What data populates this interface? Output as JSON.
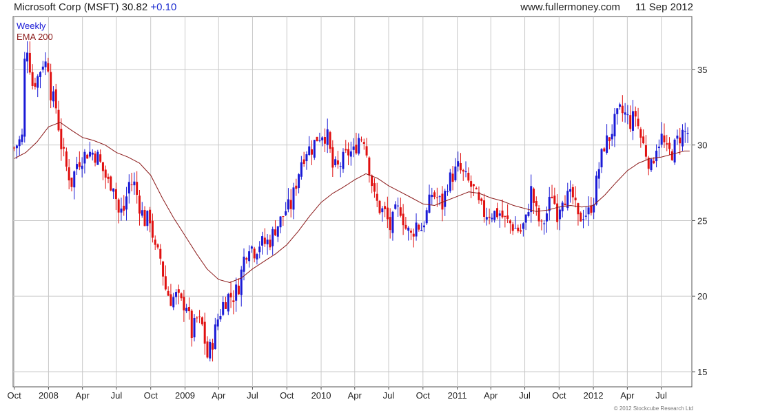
{
  "header": {
    "title": "Microsoft Corp (MSFT) 30.82",
    "change": "+0.10",
    "site": "www.fullermoney.com",
    "date": "11 Sep 2012"
  },
  "copyright": "© 2012 Stockcube Research Ltd",
  "colors": {
    "up": "#1a1ad6",
    "down": "#e01010",
    "ema": "#8b1a1a",
    "grid": "#c8c8c8",
    "legend_weekly": "#1a1ad6",
    "legend_ema": "#8b1a1a"
  },
  "chart_data": {
    "type": "candlestick",
    "legend": [
      "Weekly",
      "EMA 200"
    ],
    "legend_placement": "top-left",
    "grid": true,
    "y_axis_side": "right",
    "ylim": [
      14,
      38.5
    ],
    "y_ticks": [
      15,
      20,
      25,
      30,
      35
    ],
    "x_tick_labels": [
      "Oct",
      "2008",
      "Apr",
      "Jul",
      "Oct",
      "2009",
      "Apr",
      "Jul",
      "Oct",
      "2010",
      "Apr",
      "Jul",
      "Oct",
      "2011",
      "Apr",
      "Jul",
      "Oct",
      "2012",
      "Apr",
      "Jul"
    ],
    "x_tick_months": [
      "2007-10",
      "2008-01",
      "2008-04",
      "2008-07",
      "2008-10",
      "2009-01",
      "2009-04",
      "2009-07",
      "2009-10",
      "2010-01",
      "2010-04",
      "2010-07",
      "2010-10",
      "2011-01",
      "2011-04",
      "2011-07",
      "2011-10",
      "2012-01",
      "2012-04",
      "2012-07"
    ],
    "xlim": [
      "2007-09-28",
      "2012-09-21"
    ],
    "price_series": [
      [
        "2007-10-01",
        29.8
      ],
      [
        "2007-10-22",
        30.5
      ],
      [
        "2007-10-29",
        35.5
      ],
      [
        "2007-11-05",
        36.5
      ],
      [
        "2007-11-19",
        34.0
      ],
      [
        "2007-12-03",
        34.5
      ],
      [
        "2007-12-17",
        35.5
      ],
      [
        "2007-12-31",
        35.3
      ],
      [
        "2008-01-07",
        33.5
      ],
      [
        "2008-01-21",
        32.5
      ],
      [
        "2008-02-04",
        30.0
      ],
      [
        "2008-02-18",
        28.5
      ],
      [
        "2008-03-03",
        27.5
      ],
      [
        "2008-03-17",
        28.8
      ],
      [
        "2008-03-31",
        29.2
      ],
      [
        "2008-04-14",
        29.5
      ],
      [
        "2008-04-28",
        29.5
      ],
      [
        "2008-05-12",
        29.2
      ],
      [
        "2008-05-26",
        28.3
      ],
      [
        "2008-06-09",
        27.5
      ],
      [
        "2008-06-23",
        27.5
      ],
      [
        "2008-07-07",
        25.5
      ],
      [
        "2008-07-21",
        25.7
      ],
      [
        "2008-08-04",
        27.5
      ],
      [
        "2008-08-18",
        27.4
      ],
      [
        "2008-09-01",
        26.0
      ],
      [
        "2008-09-15",
        25.0
      ],
      [
        "2008-09-29",
        25.2
      ],
      [
        "2008-10-13",
        23.0
      ],
      [
        "2008-10-27",
        22.5
      ],
      [
        "2008-11-10",
        20.5
      ],
      [
        "2008-11-24",
        19.8
      ],
      [
        "2008-12-08",
        20.0
      ],
      [
        "2008-12-22",
        19.5
      ],
      [
        "2009-01-05",
        19.5
      ],
      [
        "2009-01-19",
        17.5
      ],
      [
        "2009-02-02",
        18.5
      ],
      [
        "2009-02-16",
        18.0
      ],
      [
        "2009-03-02",
        16.0
      ],
      [
        "2009-03-16",
        17.0
      ],
      [
        "2009-03-30",
        18.5
      ],
      [
        "2009-04-13",
        19.5
      ],
      [
        "2009-04-27",
        20.0
      ],
      [
        "2009-05-11",
        20.0
      ],
      [
        "2009-05-25",
        20.7
      ],
      [
        "2009-06-08",
        22.5
      ],
      [
        "2009-06-22",
        23.5
      ],
      [
        "2009-07-06",
        23.0
      ],
      [
        "2009-07-20",
        23.5
      ],
      [
        "2009-08-03",
        23.5
      ],
      [
        "2009-08-17",
        23.7
      ],
      [
        "2009-08-31",
        24.5
      ],
      [
        "2009-09-14",
        25.0
      ],
      [
        "2009-09-28",
        25.7
      ],
      [
        "2009-10-12",
        26.0
      ],
      [
        "2009-10-26",
        27.5
      ],
      [
        "2009-11-09",
        29.0
      ],
      [
        "2009-11-23",
        29.7
      ],
      [
        "2009-12-07",
        29.8
      ],
      [
        "2009-12-21",
        30.5
      ],
      [
        "2010-01-04",
        30.8
      ],
      [
        "2010-01-18",
        30.5
      ],
      [
        "2010-02-01",
        28.5
      ],
      [
        "2010-02-15",
        28.5
      ],
      [
        "2010-03-01",
        29.0
      ],
      [
        "2010-03-15",
        29.5
      ],
      [
        "2010-03-29",
        29.5
      ],
      [
        "2010-04-12",
        30.5
      ],
      [
        "2010-04-26",
        30.5
      ],
      [
        "2010-05-10",
        28.5
      ],
      [
        "2010-05-24",
        26.5
      ],
      [
        "2010-06-07",
        25.8
      ],
      [
        "2010-06-21",
        25.5
      ],
      [
        "2010-07-05",
        24.5
      ],
      [
        "2010-07-19",
        25.5
      ],
      [
        "2010-08-02",
        25.8
      ],
      [
        "2010-08-16",
        24.5
      ],
      [
        "2010-08-30",
        24.0
      ],
      [
        "2010-09-13",
        24.8
      ],
      [
        "2010-09-27",
        24.5
      ],
      [
        "2010-10-11",
        25.5
      ],
      [
        "2010-10-25",
        26.8
      ],
      [
        "2010-11-08",
        26.5
      ],
      [
        "2010-11-22",
        26.0
      ],
      [
        "2010-12-06",
        27.5
      ],
      [
        "2010-12-20",
        28.0
      ],
      [
        "2011-01-03",
        28.5
      ],
      [
        "2011-01-17",
        28.0
      ],
      [
        "2011-01-31",
        27.5
      ],
      [
        "2011-02-14",
        27.0
      ],
      [
        "2011-02-28",
        26.0
      ],
      [
        "2011-03-14",
        25.5
      ],
      [
        "2011-03-28",
        25.5
      ],
      [
        "2011-04-11",
        25.5
      ],
      [
        "2011-04-25",
        25.5
      ],
      [
        "2011-05-09",
        25.0
      ],
      [
        "2011-05-23",
        24.8
      ],
      [
        "2011-06-06",
        24.5
      ],
      [
        "2011-06-20",
        24.3
      ],
      [
        "2011-07-04",
        25.0
      ],
      [
        "2011-07-18",
        27.0
      ],
      [
        "2011-08-01",
        25.5
      ],
      [
        "2011-08-15",
        24.5
      ],
      [
        "2011-08-29",
        25.5
      ],
      [
        "2011-09-12",
        26.8
      ],
      [
        "2011-09-26",
        25.5
      ],
      [
        "2011-10-10",
        26.7
      ],
      [
        "2011-10-24",
        26.5
      ],
      [
        "2011-11-07",
        26.5
      ],
      [
        "2011-11-21",
        25.0
      ],
      [
        "2011-12-05",
        25.5
      ],
      [
        "2011-12-19",
        25.5
      ],
      [
        "2012-01-02",
        26.5
      ],
      [
        "2012-01-16",
        28.5
      ],
      [
        "2012-01-30",
        30.0
      ],
      [
        "2012-02-13",
        30.5
      ],
      [
        "2012-02-27",
        31.5
      ],
      [
        "2012-03-12",
        32.2
      ],
      [
        "2012-03-26",
        32.0
      ],
      [
        "2012-04-09",
        31.5
      ],
      [
        "2012-04-23",
        32.0
      ],
      [
        "2012-05-07",
        30.5
      ],
      [
        "2012-05-21",
        29.5
      ],
      [
        "2012-06-04",
        28.5
      ],
      [
        "2012-06-18",
        30.0
      ],
      [
        "2012-07-02",
        30.5
      ],
      [
        "2012-07-16",
        29.5
      ],
      [
        "2012-07-30",
        29.5
      ],
      [
        "2012-08-13",
        30.3
      ],
      [
        "2012-08-27",
        30.8
      ],
      [
        "2012-09-10",
        30.82
      ]
    ],
    "ema_series": [
      [
        "2007-10-01",
        29.1
      ],
      [
        "2007-11-01",
        29.5
      ],
      [
        "2007-12-01",
        30.2
      ],
      [
        "2008-01-01",
        31.2
      ],
      [
        "2008-02-01",
        31.5
      ],
      [
        "2008-03-01",
        31.0
      ],
      [
        "2008-04-01",
        30.5
      ],
      [
        "2008-05-01",
        30.3
      ],
      [
        "2008-06-01",
        30.0
      ],
      [
        "2008-07-01",
        29.5
      ],
      [
        "2008-08-01",
        29.2
      ],
      [
        "2008-09-01",
        28.8
      ],
      [
        "2008-10-01",
        28.0
      ],
      [
        "2008-11-01",
        26.5
      ],
      [
        "2008-12-01",
        25.2
      ],
      [
        "2009-01-01",
        24.0
      ],
      [
        "2009-02-01",
        22.8
      ],
      [
        "2009-03-01",
        21.8
      ],
      [
        "2009-04-01",
        21.1
      ],
      [
        "2009-05-01",
        20.9
      ],
      [
        "2009-06-01",
        21.2
      ],
      [
        "2009-07-01",
        21.8
      ],
      [
        "2009-08-01",
        22.3
      ],
      [
        "2009-09-01",
        22.8
      ],
      [
        "2009-10-01",
        23.4
      ],
      [
        "2009-11-01",
        24.3
      ],
      [
        "2009-12-01",
        25.3
      ],
      [
        "2010-01-01",
        26.2
      ],
      [
        "2010-02-01",
        26.8
      ],
      [
        "2010-03-01",
        27.2
      ],
      [
        "2010-04-01",
        27.7
      ],
      [
        "2010-05-01",
        28.1
      ],
      [
        "2010-06-01",
        27.8
      ],
      [
        "2010-07-01",
        27.3
      ],
      [
        "2010-08-01",
        26.9
      ],
      [
        "2010-09-01",
        26.5
      ],
      [
        "2010-10-01",
        26.1
      ],
      [
        "2010-11-01",
        26.0
      ],
      [
        "2010-12-01",
        26.3
      ],
      [
        "2011-01-01",
        26.6
      ],
      [
        "2011-02-01",
        26.9
      ],
      [
        "2011-03-01",
        26.8
      ],
      [
        "2011-04-01",
        26.5
      ],
      [
        "2011-05-01",
        26.3
      ],
      [
        "2011-06-01",
        26.0
      ],
      [
        "2011-07-01",
        25.8
      ],
      [
        "2011-08-01",
        25.6
      ],
      [
        "2011-09-01",
        25.7
      ],
      [
        "2011-10-01",
        25.9
      ],
      [
        "2011-11-01",
        26.0
      ],
      [
        "2011-12-01",
        25.9
      ],
      [
        "2012-01-01",
        26.0
      ],
      [
        "2012-02-01",
        26.7
      ],
      [
        "2012-03-01",
        27.5
      ],
      [
        "2012-04-01",
        28.3
      ],
      [
        "2012-05-01",
        28.8
      ],
      [
        "2012-06-01",
        29.1
      ],
      [
        "2012-07-01",
        29.2
      ],
      [
        "2012-08-01",
        29.4
      ],
      [
        "2012-09-01",
        29.6
      ],
      [
        "2012-09-15",
        29.6
      ]
    ]
  }
}
